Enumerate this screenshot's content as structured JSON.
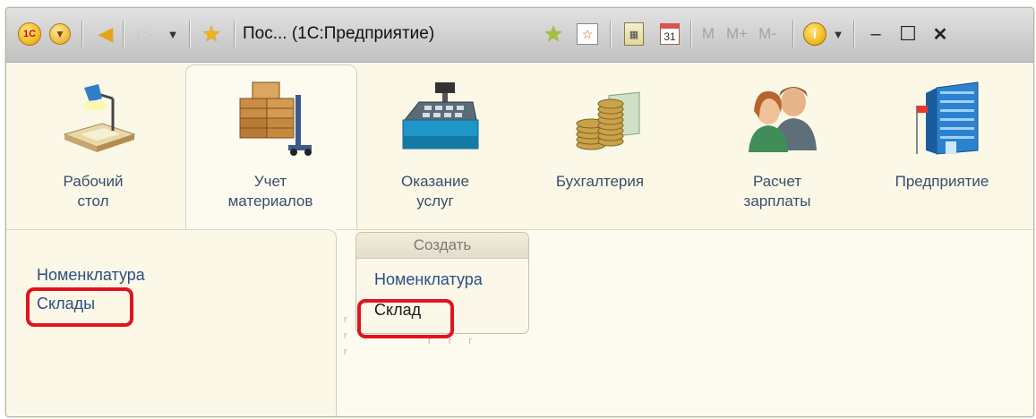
{
  "titlebar": {
    "logo_text": "1С",
    "title": "Пос... (1С:Предприятие)",
    "mem_m": "M",
    "mem_mplus": "M+",
    "mem_mminus": "M-",
    "calendar_day": "31",
    "info": "i",
    "icons": [
      "app-logo-icon",
      "main-menu-icon",
      "back-arrow-icon",
      "forward-arrow-icon",
      "history-dropdown-icon",
      "favorites-star-icon",
      "add-favorite-star-icon",
      "bookmark-icon",
      "calculator-icon",
      "calendar-icon",
      "info-icon",
      "minimize-icon",
      "maximize-icon",
      "close-icon"
    ]
  },
  "sections": [
    {
      "label": "Рабочий\nстол",
      "icon": "desk-lamp-icon"
    },
    {
      "label": "Учет\nматериалов",
      "icon": "warehouse-boxes-icon"
    },
    {
      "label": "Оказание\nуслуг",
      "icon": "cash-register-icon"
    },
    {
      "label": "Бухгалтерия",
      "icon": "coins-icon"
    },
    {
      "label": "Расчет\nзарплаты",
      "icon": "employees-icon"
    },
    {
      "label": "Предприятие",
      "icon": "building-icon"
    }
  ],
  "nav": {
    "items": [
      "Номенклатура",
      "Склады"
    ]
  },
  "create": {
    "header": "Создать",
    "items": [
      "Номенклатура",
      "Склад"
    ]
  },
  "colors": {
    "highlight": "#e0141e",
    "link": "#2a4f82",
    "panel_bg": "#fbf8e8"
  }
}
